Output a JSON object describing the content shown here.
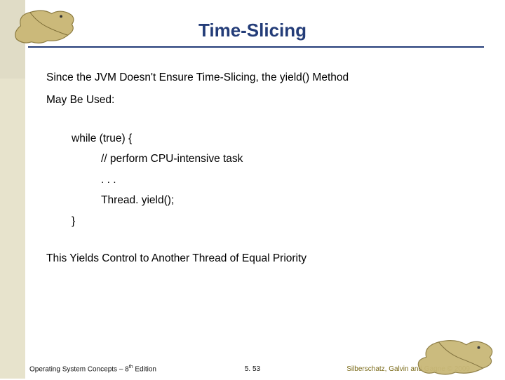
{
  "title": "Time-Slicing",
  "intro_line1": "Since the JVM Doesn't Ensure Time-Slicing, the yield() Method",
  "intro_line2": "May Be Used:",
  "code": {
    "l1": "while (true) {",
    "l2": "// perform CPU-intensive task",
    "l3": ". . .",
    "l4": "Thread. yield();",
    "l5": "}"
  },
  "outro": "This Yields Control to Another Thread of Equal Priority",
  "footer": {
    "left_a": "Operating System Concepts – 8",
    "left_sup": "th",
    "left_b": " Edition",
    "mid": "5. 53",
    "right": "Silberschatz, Galvin and Gagne © 2009"
  },
  "icons": {
    "dino": "dinosaur-illustration"
  }
}
